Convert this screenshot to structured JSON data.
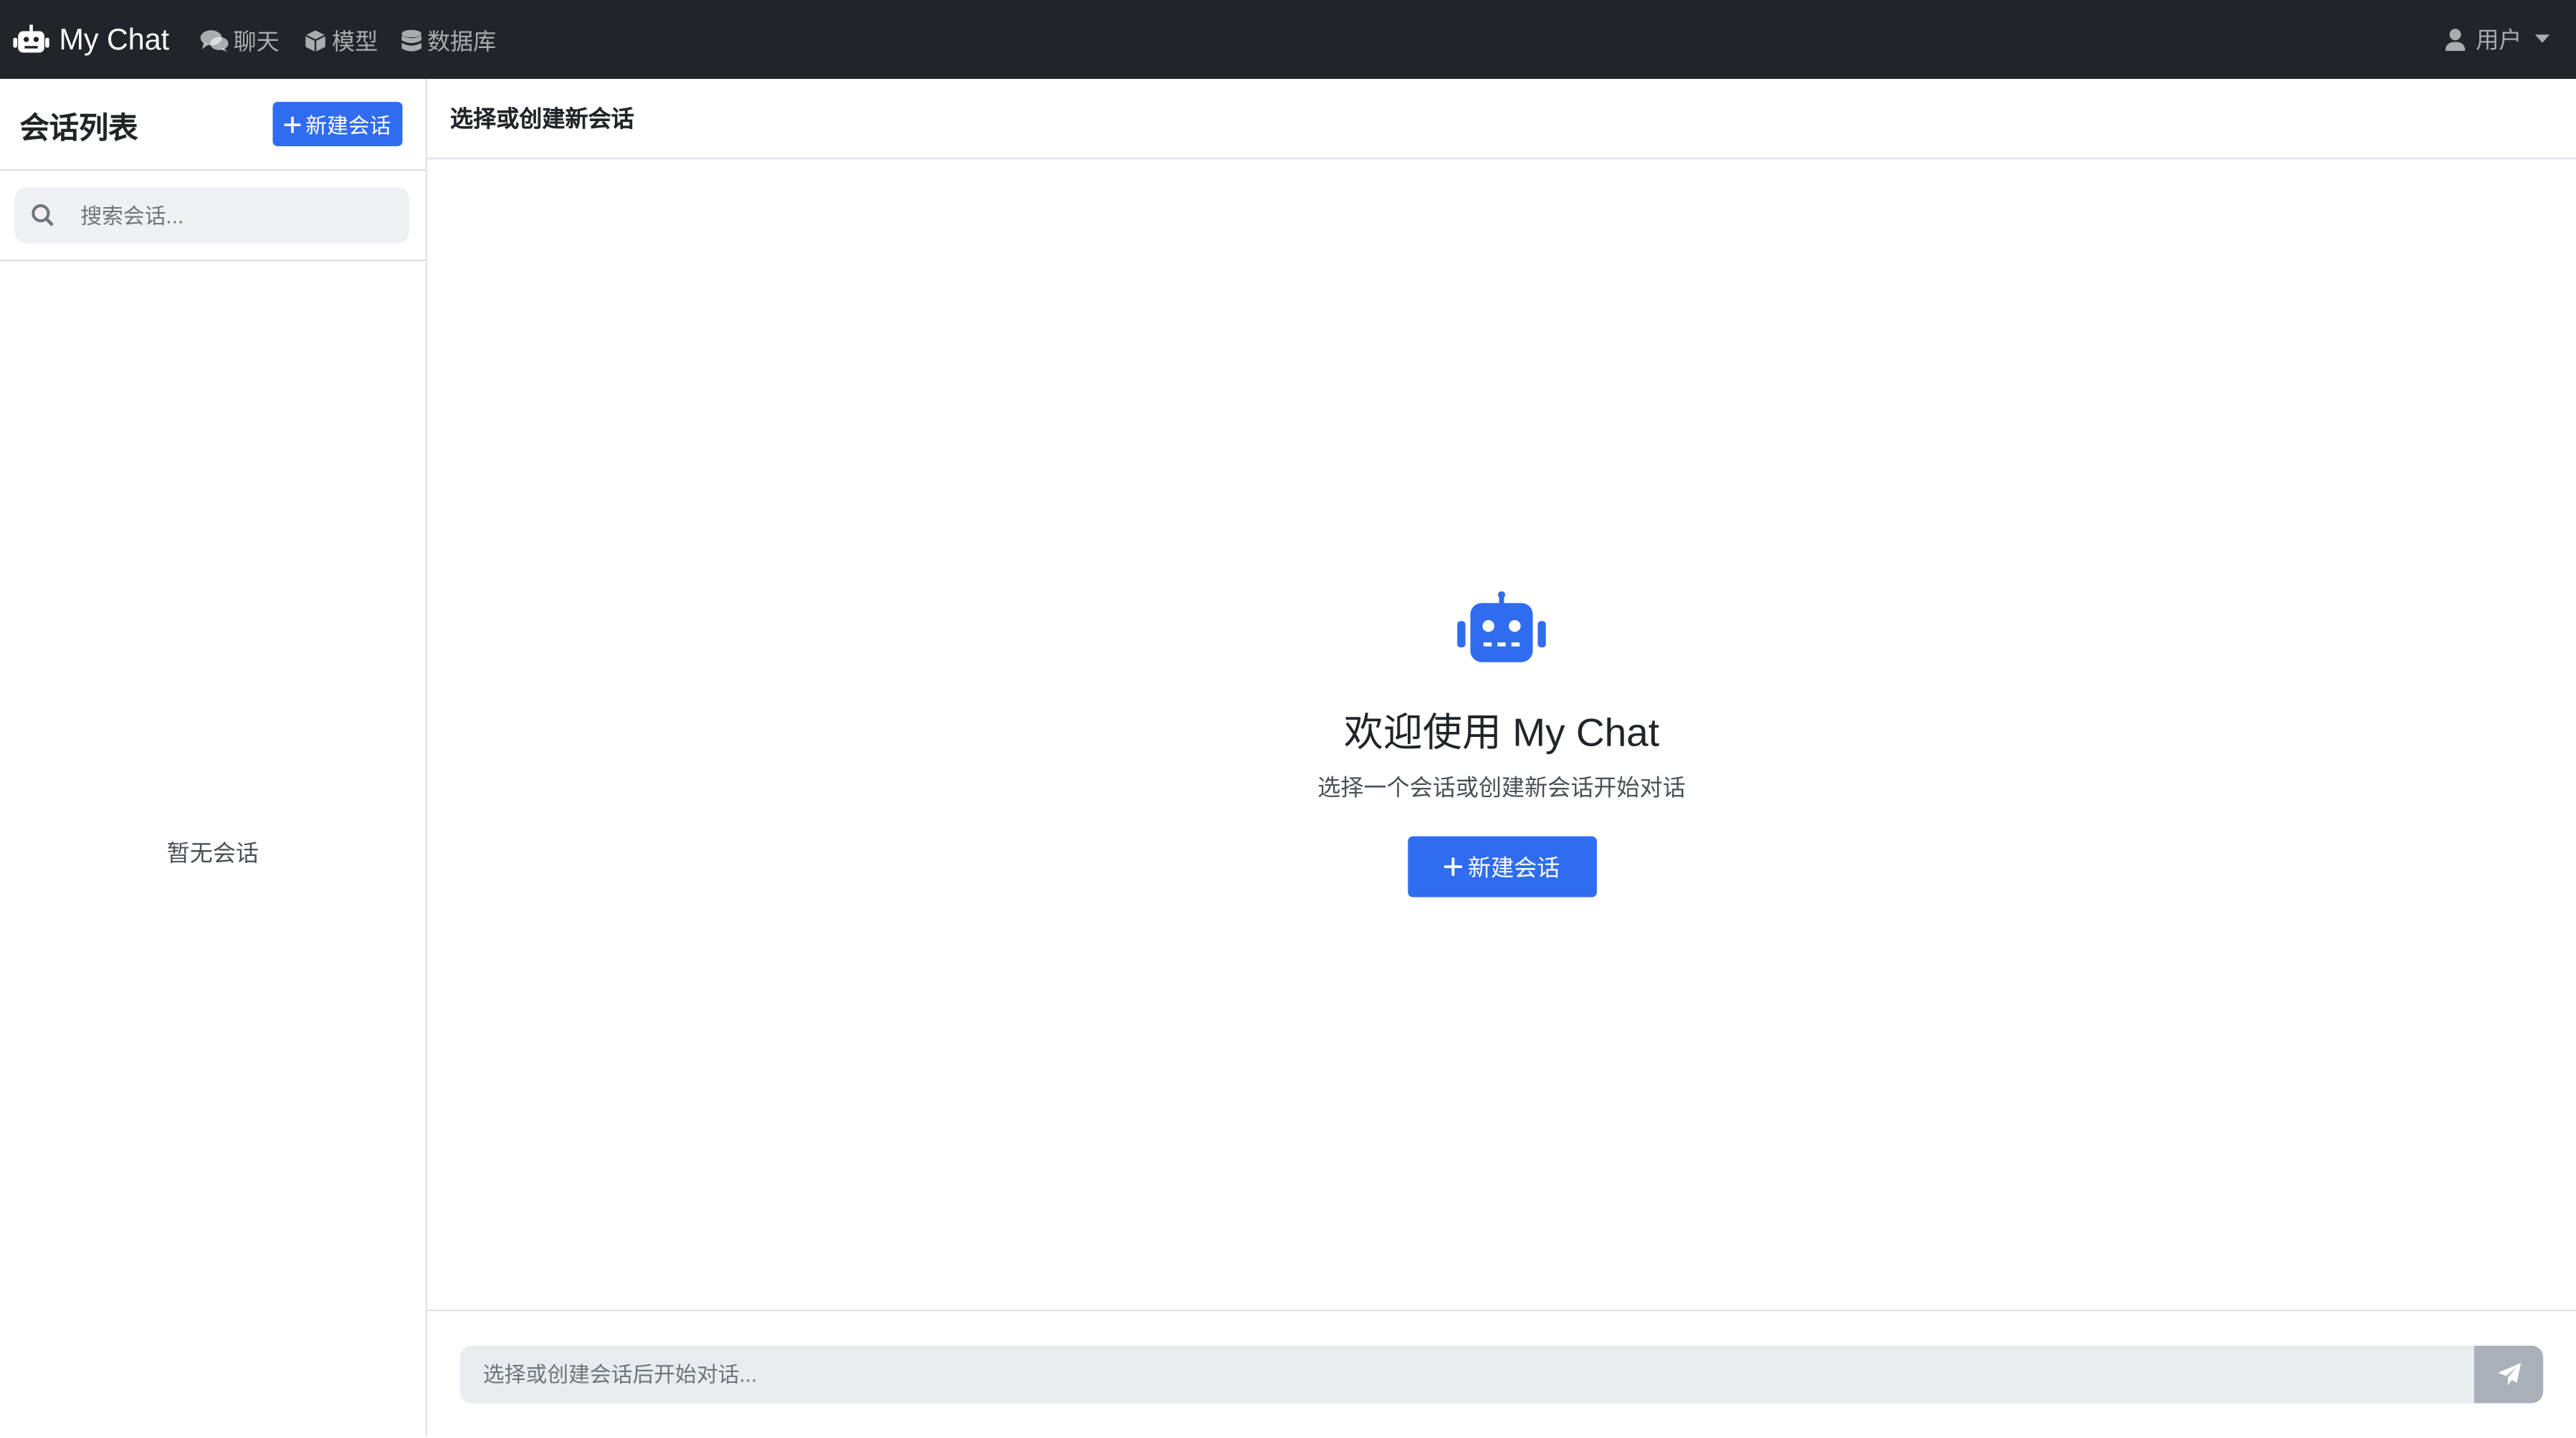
{
  "navbar": {
    "brand": "My Chat",
    "links": [
      {
        "label": "聊天",
        "icon": "comments-icon"
      },
      {
        "label": "模型",
        "icon": "cube-icon"
      },
      {
        "label": "数据库",
        "icon": "database-icon"
      }
    ],
    "user_label": "用户"
  },
  "sidebar": {
    "title": "会话列表",
    "new_button": "新建会话",
    "search_placeholder": "搜索会话...",
    "empty_text": "暂无会话"
  },
  "main": {
    "header_title": "选择或创建新会话",
    "welcome_title": "欢迎使用 My Chat",
    "welcome_subtitle": "选择一个会话或创建新会话开始对话",
    "new_button": "新建会话",
    "input_placeholder": "选择或创建会话后开始对话..."
  },
  "colors": {
    "navbar_bg": "#212529",
    "primary": "#2f6cf0",
    "send_disabled": "#a9b0b9"
  }
}
